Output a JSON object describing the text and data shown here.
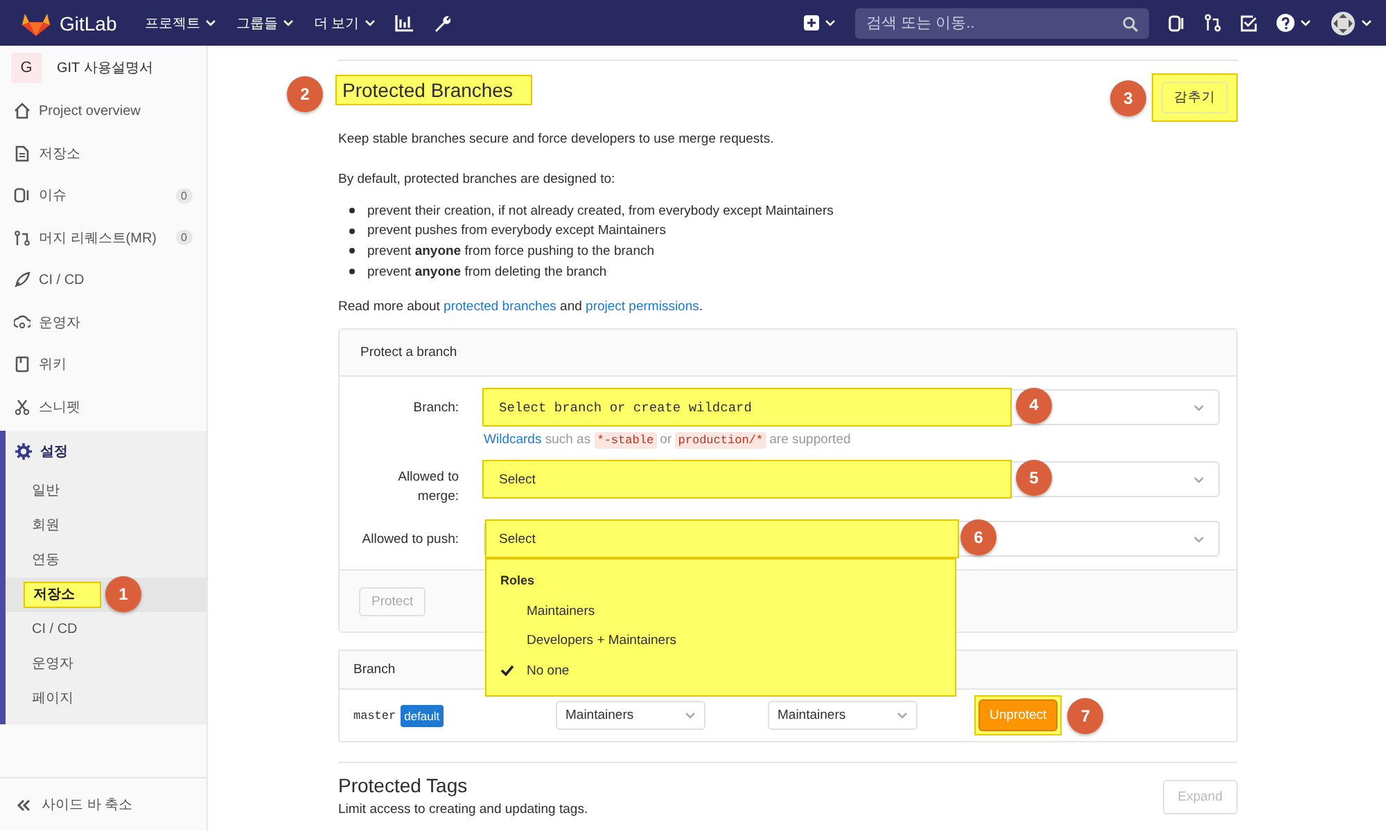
{
  "topbar": {
    "logo": "GitLab",
    "nav": [
      {
        "label": "프로젝트"
      },
      {
        "label": "그룹들"
      },
      {
        "label": "더 보기"
      }
    ],
    "search": {
      "placeholder": "검색 또는 이동.."
    }
  },
  "sidebar": {
    "project": {
      "avatar": "G",
      "name": "GIT 사용설명서"
    },
    "items": [
      {
        "label": "Project overview",
        "selected": false
      },
      {
        "label": "저장소",
        "selected": false
      },
      {
        "label": "이슈",
        "count": "0",
        "selected": false
      },
      {
        "label": "머지 리퀘스트(MR)",
        "count": "0",
        "selected": false
      },
      {
        "label": "CI / CD",
        "selected": false
      },
      {
        "label": "운영자",
        "selected": false
      },
      {
        "label": "위키",
        "selected": false
      },
      {
        "label": "스니펫",
        "selected": false
      },
      {
        "label": "설정",
        "selected": true,
        "expanded": true,
        "children": [
          {
            "label": "일반",
            "selected": false
          },
          {
            "label": "회원",
            "selected": false
          },
          {
            "label": "연동",
            "selected": false
          },
          {
            "label": "저장소",
            "selected": true,
            "highlighted": true,
            "marker": "1"
          },
          {
            "label": "CI / CD",
            "selected": false
          },
          {
            "label": "운영자",
            "selected": false
          },
          {
            "label": "페이지",
            "selected": false
          }
        ]
      }
    ],
    "collapse": "사이드 바 축소"
  },
  "section": {
    "title": "Protected Branches",
    "title_highlighted": true,
    "title_marker": "2",
    "hide_button": "감추기",
    "hide_highlighted": true,
    "hide_marker": "3",
    "intro": "Keep stable branches secure and force developers to use merge requests.",
    "default_intro": "By default, protected branches are designed to:",
    "bullets": [
      "prevent their creation, if not already created, from everybody except Maintainers",
      "prevent pushes from everybody except Maintainers",
      "prevent **anyone** from force pushing to the branch",
      "prevent **anyone** from deleting the branch"
    ],
    "read_more": [
      {
        "text": "Read more about "
      },
      {
        "link": "protected branches"
      },
      {
        "text": " and "
      },
      {
        "link": "project permissions"
      },
      {
        "text": "."
      }
    ]
  },
  "protect_form": {
    "header": "Protect a branch",
    "fields": [
      {
        "kind": "branch",
        "label": "Branch:",
        "value": "Select branch or create wildcard",
        "highlighted": true,
        "marker": "4",
        "hint": [
          {
            "link": "Wildcards"
          },
          {
            "text": " such as "
          },
          {
            "code": "*-stable"
          },
          {
            "text": " or "
          },
          {
            "code": "production/*"
          },
          {
            "text": " are supported"
          }
        ]
      },
      {
        "kind": "role",
        "label": "Allowed to merge:",
        "value": "Select",
        "highlighted": true,
        "marker": "5"
      },
      {
        "kind": "role",
        "label": "Allowed to push:",
        "value": "Select",
        "highlighted": true,
        "marker": "6",
        "dropdown": {
          "header": "Roles",
          "options": [
            {
              "label": "Maintainers",
              "selected": false
            },
            {
              "label": "Developers + Maintainers",
              "selected": false
            },
            {
              "label": "No one",
              "selected": true
            }
          ]
        }
      }
    ],
    "button": {
      "label": "Protect",
      "disabled": true
    }
  },
  "branch_table": {
    "columns": [
      "Branch"
    ],
    "rows": [
      {
        "branch": "master",
        "badge": "default",
        "merge": "Maintainers",
        "push": "Maintainers",
        "action": "Unprotect",
        "action_highlighted": true,
        "marker": "7"
      }
    ]
  },
  "tags_section": {
    "title": "Protected Tags",
    "text": "Limit access to creating and updating tags.",
    "button": "Expand"
  }
}
